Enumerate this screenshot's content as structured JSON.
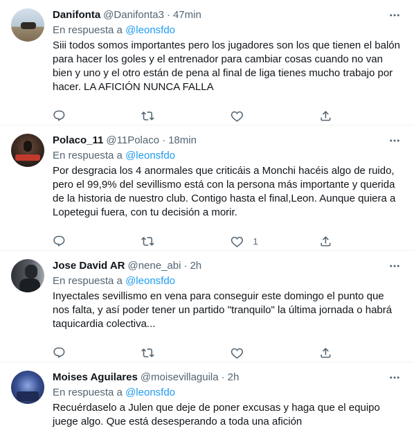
{
  "tweets": [
    {
      "name": "Danifonta",
      "handle": "@Danifonta3",
      "time": "47min",
      "reply_prefix": "En respuesta a ",
      "reply_to": "@leonsfdo",
      "text": "Siii todos somos importantes pero los jugadores son los que tienen el balón para hacer los goles y el entrenador para cambiar cosas cuando no van bien y uno y el otro están de pena al final de liga tienes mucho trabajo por hacer. LA AFICIÓN NUNCA FALLA",
      "like_count": "",
      "avatar_colors": [
        "#c9d6e3",
        "#8a7a63"
      ]
    },
    {
      "name": "Polaco_11",
      "handle": "@11Polaco",
      "time": "18min",
      "reply_prefix": "En respuesta a ",
      "reply_to": "@leonsfdo",
      "text": "Por desgracia los 4 anormales que criticáis a Monchi hacéis algo de ruido, pero el 99,9% del sevillismo está con la persona más importante y querida de la historia de nuestro club. Contigo hasta el final,Leon. Aunque quiera a Lopetegui fuera, con tu decisión a morir.",
      "like_count": "1",
      "avatar_colors": [
        "#2b1f1a",
        "#c23a2c"
      ]
    },
    {
      "name": "Jose David AR",
      "handle": "@nene_abi",
      "time": "2h",
      "reply_prefix": "En respuesta a ",
      "reply_to": "@leonsfdo",
      "text": "Inyectales sevillismo en vena para conseguir este domingo el punto que nos falta, y así poder tener un partido \"tranquilo\" la última jornada o habrá taquicardia colectiva...",
      "like_count": "",
      "avatar_colors": [
        "#3c4046",
        "#9aa0a6"
      ]
    },
    {
      "name": "Moises Aguilares",
      "handle": "@moisevillaguila",
      "time": "2h",
      "reply_prefix": "En respuesta a ",
      "reply_to": "@leonsfdo",
      "text": "Recuérdaselo a Julen que deje de poner excusas y haga que el equipo juege algo. Que está desesperando a toda una afición",
      "like_count": "",
      "avatar_colors": [
        "#1c2a5a",
        "#6a85c7"
      ]
    }
  ],
  "separator": "·",
  "icons": {
    "more": "more-horizontal-icon",
    "reply": "reply-icon",
    "retweet": "retweet-icon",
    "like": "like-icon",
    "share": "share-icon"
  },
  "colors": {
    "link": "#1d9bf0",
    "secondary_text": "#536471",
    "primary_text": "#0f1419",
    "divider": "#eff3f4"
  }
}
